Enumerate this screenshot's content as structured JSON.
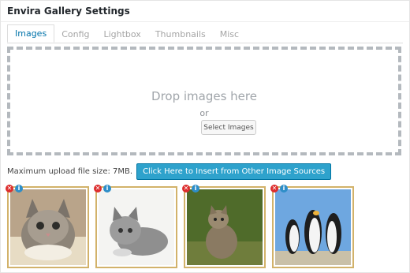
{
  "header": {
    "title": "Envira Gallery Settings"
  },
  "tabs": [
    {
      "label": "Images"
    },
    {
      "label": "Config"
    },
    {
      "label": "Lightbox"
    },
    {
      "label": "Thumbnails"
    },
    {
      "label": "Misc"
    }
  ],
  "dropzone": {
    "drop_text": "Drop images here",
    "or_text": "or",
    "select_label": "Select Images"
  },
  "upload": {
    "max_size_text": "Maximum upload file size: 7MB.",
    "insert_label": "Click Here to Insert from Other Image Sources"
  },
  "images": [
    {
      "subject": "kitten"
    },
    {
      "subject": "kitten"
    },
    {
      "subject": "cat"
    },
    {
      "subject": "penguins"
    }
  ],
  "icons": {
    "remove": "remove-icon",
    "info": "info-icon"
  },
  "colors": {
    "accent": "#0073aa",
    "button": "#2ea2cc",
    "thumb_border": "#d2b26a",
    "remove": "#dd2d2d",
    "info": "#2e8ec8"
  }
}
